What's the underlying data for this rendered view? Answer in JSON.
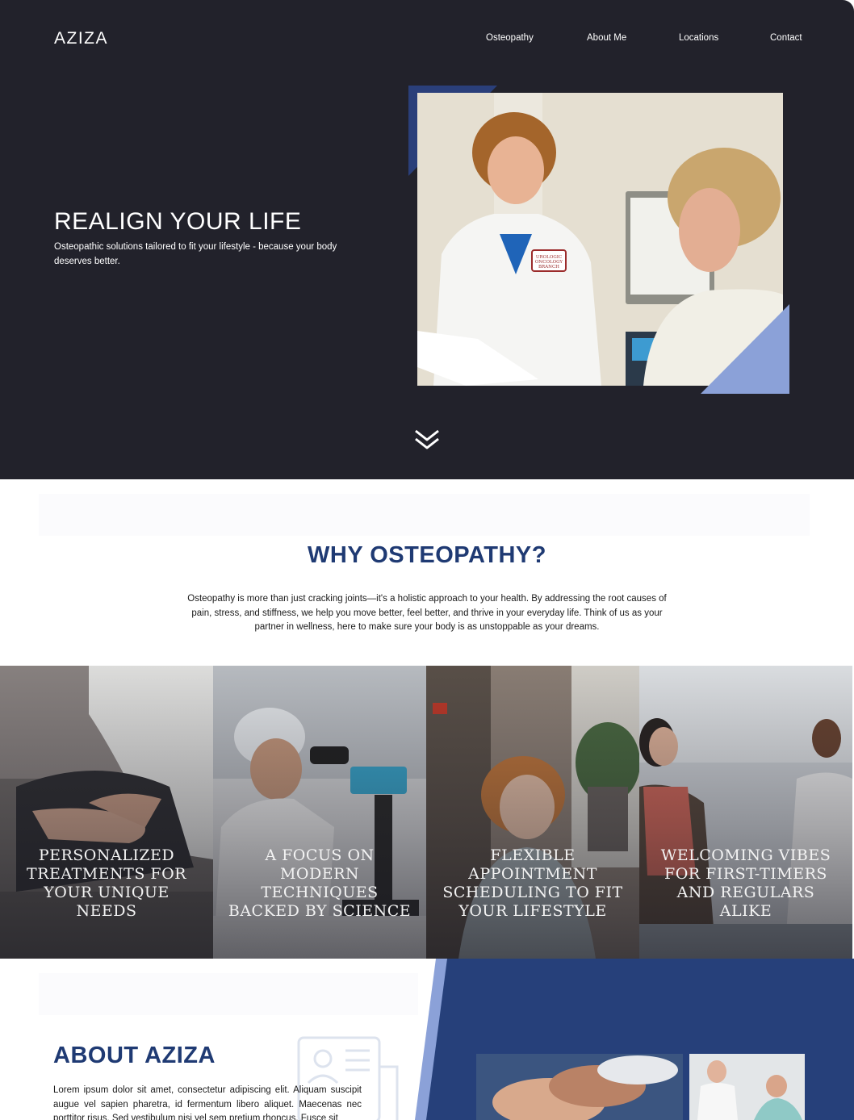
{
  "brand": {
    "logo": "AZIZA"
  },
  "nav": {
    "items": [
      "Osteopathy",
      "About Me",
      "Locations",
      "Contact"
    ]
  },
  "hero": {
    "title": "REALIGN YOUR LIFE",
    "subtitle": "Osteopathic solutions tailored to fit your lifestyle - because your body deserves better.",
    "badge_text": [
      "UROLOGIC",
      "ONCOLOGY",
      "BRANCH"
    ]
  },
  "why": {
    "title": "WHY OSTEOPATHY?",
    "text": "Osteopathy is more than just cracking joints—it's a holistic approach to your health. By addressing the root causes of pain, stress, and stiffness, we help you move better, feel better, and thrive in your everyday life. Think of us as your partner in wellness, here to make sure your body is as unstoppable as your dreams."
  },
  "cards": [
    {
      "label": "Personalized treatments for your unique needs"
    },
    {
      "label": "A focus on modern techniques backed by science"
    },
    {
      "label": "Flexible appointment scheduling to fit your lifestyle"
    },
    {
      "label": "Welcoming vibes for first-timers and regulars alike"
    }
  ],
  "about": {
    "title": "ABOUT AZIZA",
    "text": "Lorem ipsum dolor sit amet, consectetur adipiscing elit. Aliquam suscipit augue vel sapien pharetra, id fermentum libero aliquet. Maecenas nec porttitor risus. Sed vestibulum nisi vel sem pretium rhoncus. Fusce sit"
  },
  "colors": {
    "hero_bg": "#22222b",
    "navy": "#26407a",
    "heading_blue": "#1f3a73",
    "light_blue": "#8ba1d8"
  },
  "icons": {
    "scroll": "double-chevron-down-icon",
    "about_watermark": "profile-document-icon"
  }
}
